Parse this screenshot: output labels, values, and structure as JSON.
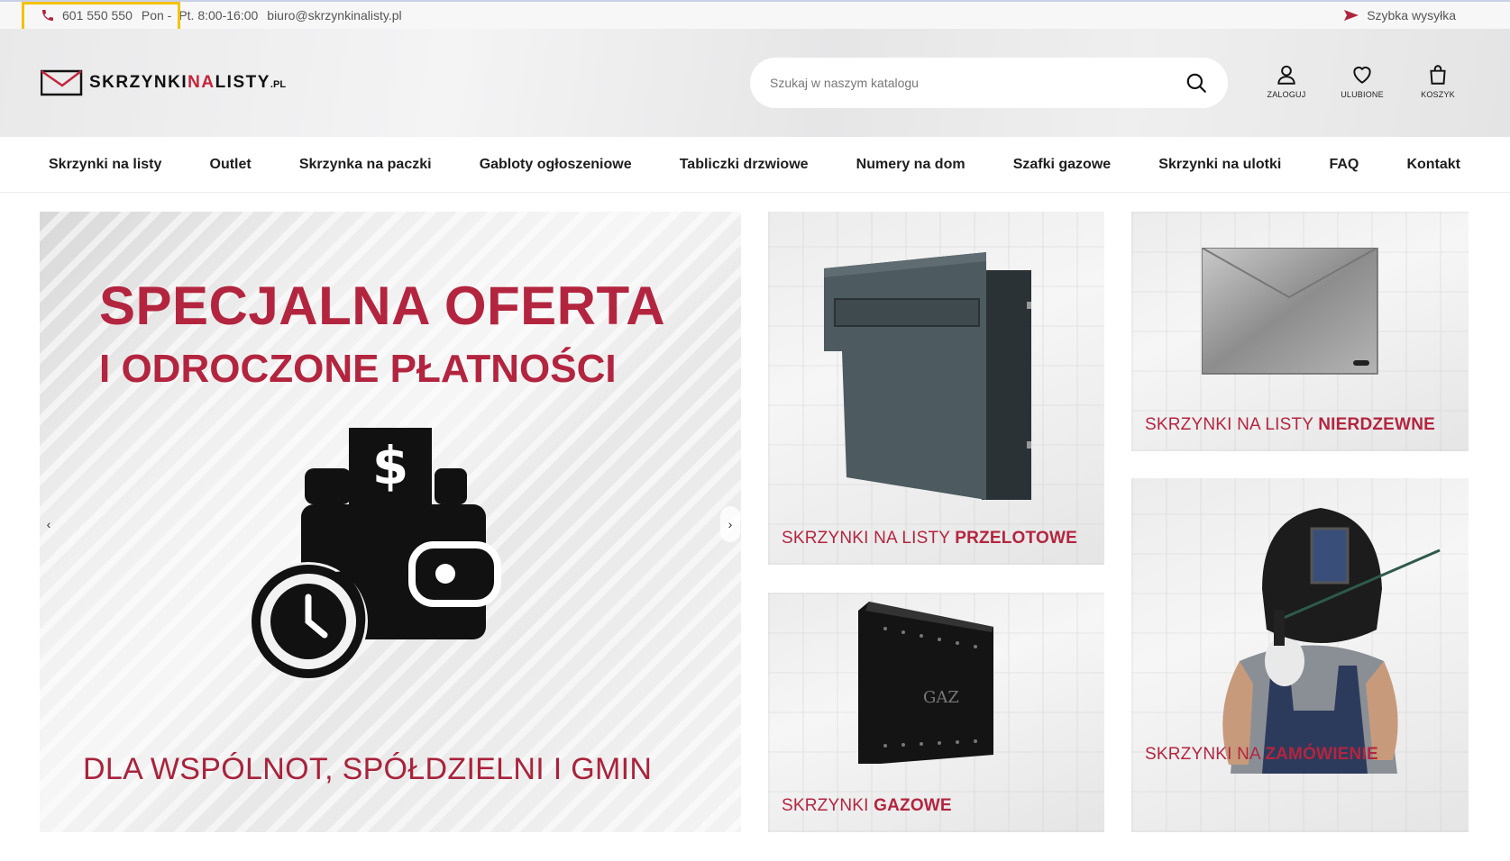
{
  "topbar": {
    "phone": "601 550 550",
    "hours_day": "Pon -",
    "hours_time": "Pt. 8:00-16:00",
    "email": "biuro@skrzynkinalisty.pl",
    "shipping": "Szybka wysyłka"
  },
  "header": {
    "logo": {
      "part1": "SKRZYNKI",
      "part2": "NA",
      "part3": "LISTY",
      "tld": ".PL"
    },
    "search_placeholder": "Szukaj w naszym katalogu",
    "icons": [
      {
        "label": "ZALOGUJ",
        "icon": "user-icon"
      },
      {
        "label": "ULUBIONE",
        "icon": "heart-icon"
      },
      {
        "label": "KOSZYK",
        "icon": "bag-icon"
      }
    ]
  },
  "nav": {
    "items": [
      "Skrzynki na listy",
      "Outlet",
      "Skrzynka na paczki",
      "Gabloty ogłoszeniowe",
      "Tabliczki drzwiowe",
      "Numery na dom",
      "Szafki gazowe",
      "Skrzynki na ulotki",
      "FAQ",
      "Kontakt"
    ]
  },
  "hero": {
    "headline": "SPECJALNA OFERTA",
    "subheadline": "I ODROCZONE PŁATNOŚCI",
    "bottom_text": "DLA WSPÓLNOT, SPÓŁDZIELNI I GMIN",
    "prev_arrow": "‹",
    "next_arrow": "›"
  },
  "tiles": [
    {
      "normal": "SKRZYNKI NA LISTY ",
      "bold": "PRZELOTOWE"
    },
    {
      "normal": "SKRZYNKI NA LISTY ",
      "bold": "NIERDZEWNE"
    },
    {
      "normal": "SKRZYNKI ",
      "bold": "GAZOWE",
      "product_label": "GAZ"
    },
    {
      "normal": "SKRZYNKI NA ",
      "bold": "ZAMÓWIENIE"
    }
  ],
  "colors": {
    "accent": "#b3253f",
    "brand_red": "#c4243a",
    "highlight": "#f3c200"
  }
}
